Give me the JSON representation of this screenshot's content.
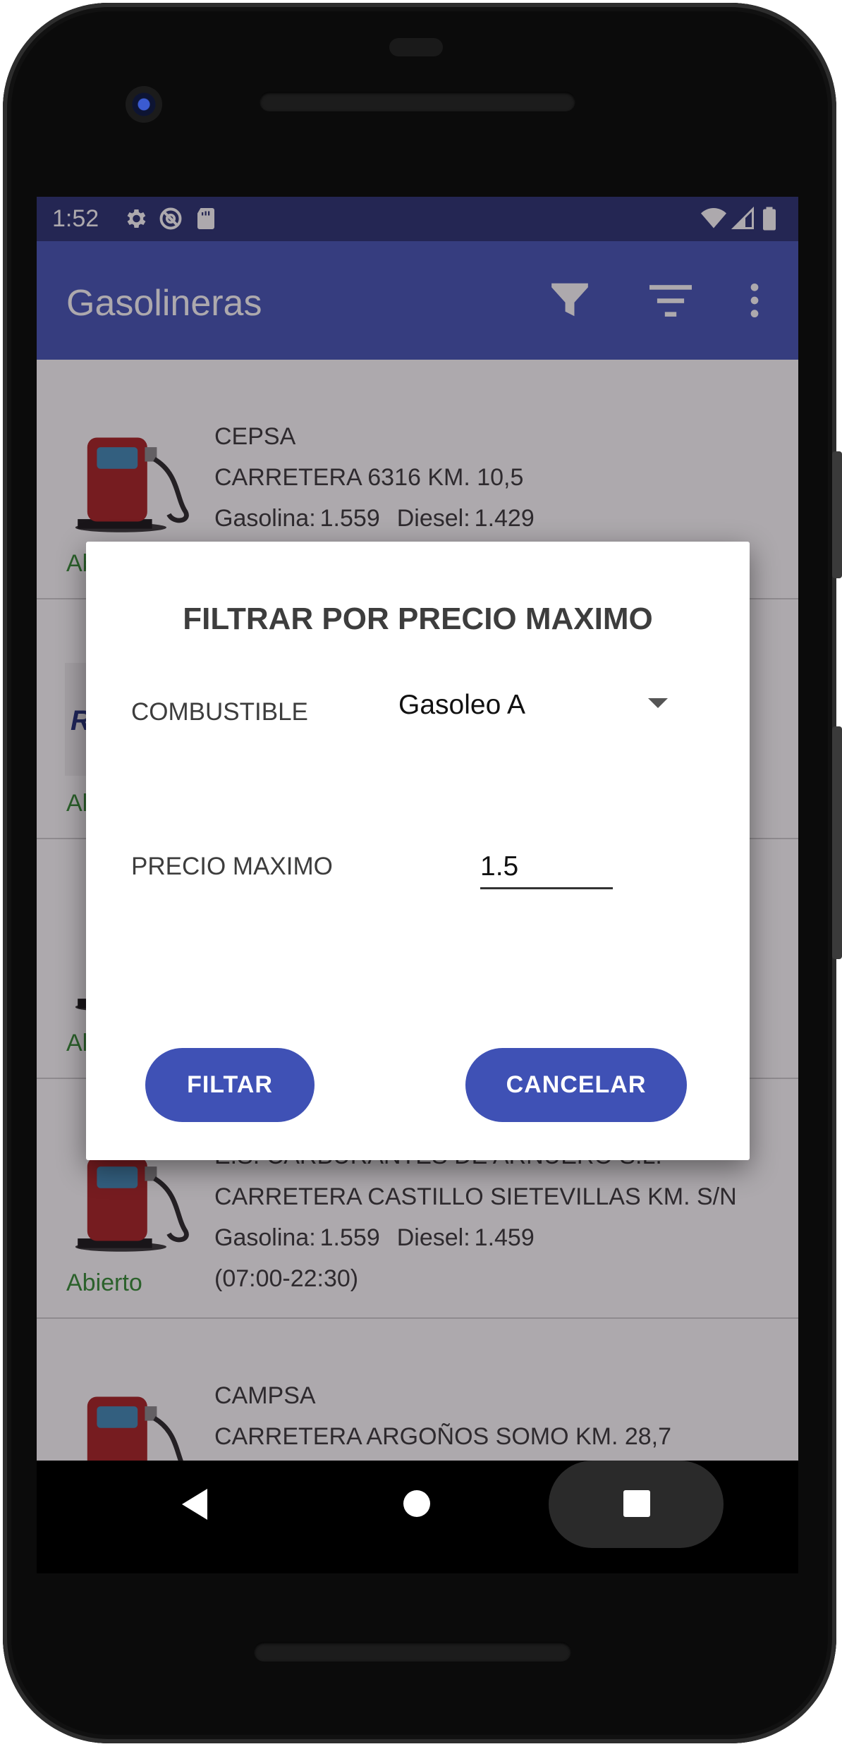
{
  "status_bar": {
    "time": "1:52",
    "left_icons": [
      "gear-icon",
      "no-sync-icon",
      "sd-card-icon"
    ],
    "right_icons": [
      "wifi-icon",
      "cell-signal-icon",
      "battery-icon"
    ]
  },
  "app_bar": {
    "title": "Gasolineras",
    "actions": [
      "filter-icon",
      "sort-icon",
      "overflow-menu-icon"
    ],
    "color": "#3f51b5"
  },
  "stations": [
    {
      "brand": "CEPSA",
      "address": "CARRETERA 6316 KM. 10,5",
      "gasolina_label": "Gasolina:",
      "gasolina": "1.559",
      "diesel_label": "Diesel:",
      "diesel": "1.429",
      "status": "Ab"
    },
    {
      "status": "Al",
      "logo_text": "R"
    },
    {
      "status": "Al"
    },
    {
      "brand": "E.S. CARBURANTES DE ARNUERO S.L.",
      "address": "CARRETERA CASTILLO SIETEVILLAS KM. S/N",
      "gasolina_label": "Gasolina:",
      "gasolina": "1.559",
      "diesel_label": "Diesel:",
      "diesel": "1.459",
      "hours": "(07:00-22:30)",
      "status": "Abierto"
    },
    {
      "brand": "CAMPSA",
      "address": "CARRETERA ARGOÑOS SOMO KM. 28,7"
    }
  ],
  "dialog": {
    "title": "FILTRAR POR PRECIO MAXIMO",
    "fuel_label": "COMBUSTIBLE",
    "fuel_selected": "Gasoleo A",
    "price_label": "PRECIO MAXIMO",
    "price_value": "1.5",
    "filter_button": "FILTAR",
    "cancel_button": "CANCELAR"
  },
  "colors": {
    "status_bar": "#232d6f",
    "primary": "#3f51b5",
    "open_status": "#2e8b2e"
  }
}
